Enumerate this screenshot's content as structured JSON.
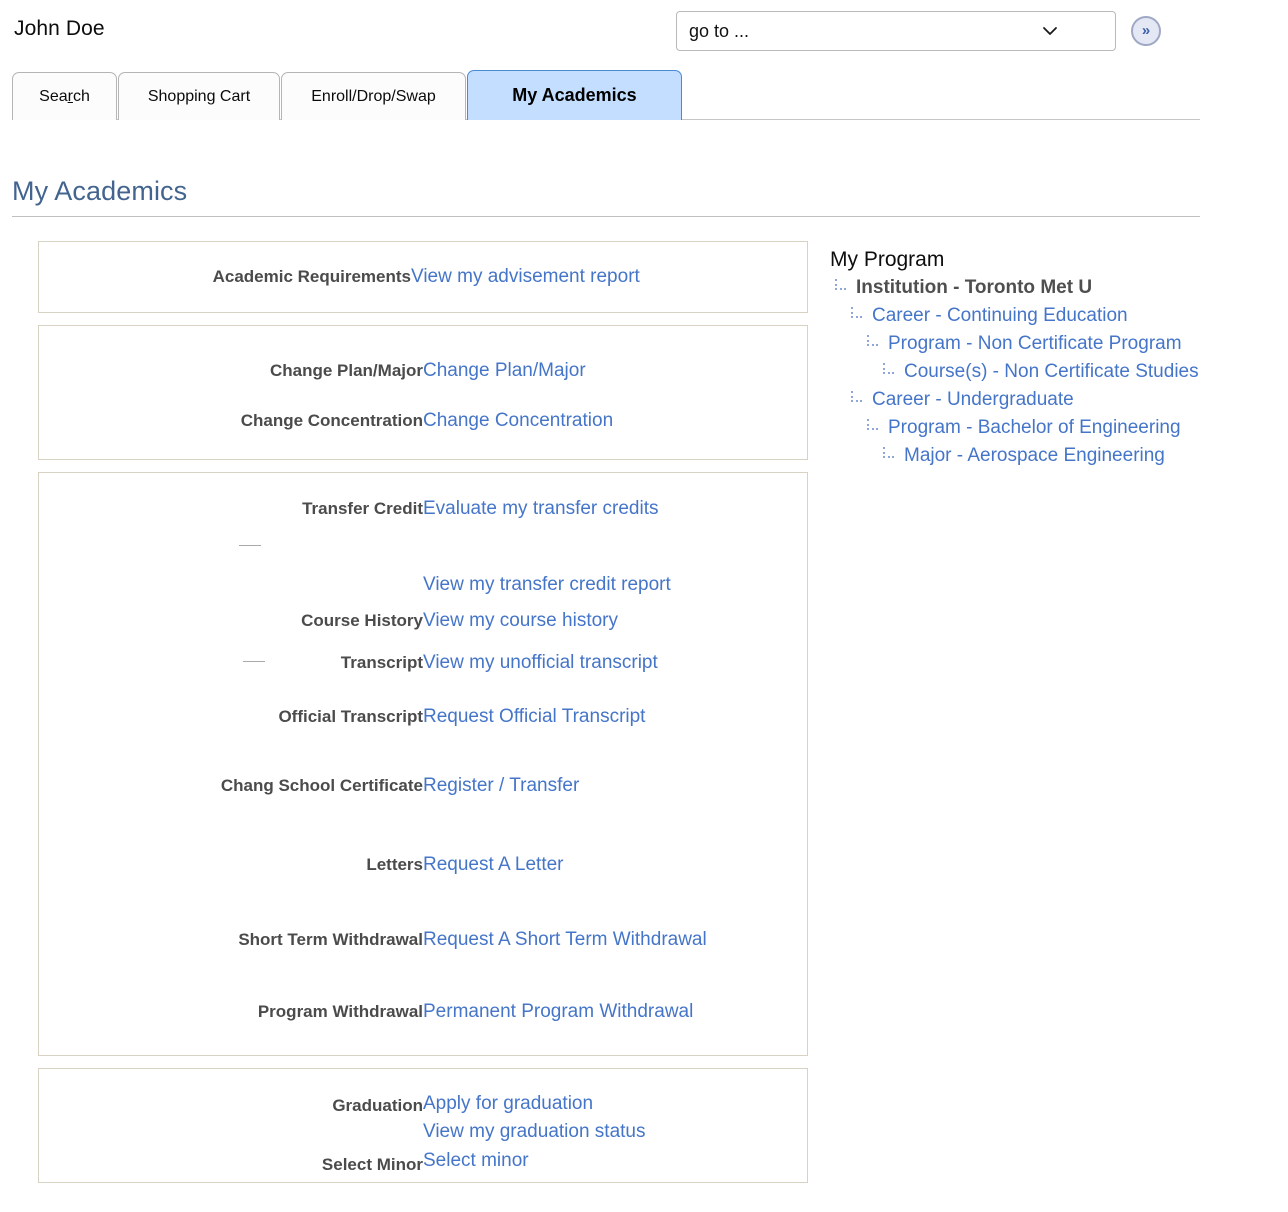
{
  "header": {
    "user_name": "John Doe",
    "goto": {
      "selected": "go to ...",
      "options": [
        "go to ..."
      ],
      "chevron_icon": "chevron-down-icon"
    },
    "go_button": {
      "glyph": "»",
      "icon": "double-chevron-right-icon"
    }
  },
  "tabs": [
    {
      "label": "Search",
      "accesskey_index": 3,
      "active": false
    },
    {
      "label": "Shopping Cart",
      "active": false
    },
    {
      "label": "Enroll/Drop/Swap",
      "active": false
    },
    {
      "label": "My Academics",
      "active": true
    }
  ],
  "page": {
    "title": "My Academics"
  },
  "panels": [
    {
      "name": "academic-requirements",
      "rows": [
        {
          "label": "Academic Requirements",
          "links": [
            "View my advisement report"
          ]
        }
      ]
    },
    {
      "name": "change-plan",
      "rows": [
        {
          "label": "Change Plan/Major",
          "links": [
            "Change Plan/Major"
          ]
        },
        {
          "label": "Change Concentration",
          "links": [
            "Change Concentration"
          ]
        }
      ]
    },
    {
      "name": "records-and-requests",
      "rows": [
        {
          "label": "Transfer Credit",
          "links": [
            "Evaluate my transfer credits"
          ]
        },
        {
          "label": "",
          "dash": true,
          "links": []
        },
        {
          "label": "",
          "links": [
            "View my transfer credit report"
          ]
        },
        {
          "label": "Course History",
          "links": [
            "View my course history"
          ]
        },
        {
          "label": "Transcript",
          "dash": true,
          "links": [
            "View my unofficial transcript"
          ]
        },
        {
          "label": "Official Transcript",
          "links": [
            "Request Official Transcript"
          ]
        },
        {
          "label": "Chang School Certificate",
          "links": [
            "Register / Transfer"
          ]
        },
        {
          "label": "Letters",
          "links": [
            "Request A Letter"
          ]
        },
        {
          "label": "Short Term Withdrawal",
          "links": [
            "Request A Short Term Withdrawal"
          ]
        },
        {
          "label": "Program Withdrawal",
          "links": [
            "Permanent Program Withdrawal"
          ]
        }
      ]
    },
    {
      "name": "graduation",
      "rows": [
        {
          "label": "Graduation",
          "links": [
            "Apply for graduation",
            "View my graduation status"
          ]
        },
        {
          "label": "Select Minor",
          "links": [
            "Select minor"
          ]
        }
      ]
    }
  ],
  "my_program": {
    "title": "My Program",
    "nodes": [
      {
        "label": "Institution - Toronto Met U",
        "level": 0,
        "type": "text"
      },
      {
        "label": "Career - Continuing Education",
        "level": 1,
        "type": "link"
      },
      {
        "label": "Program - Non Certificate Program",
        "level": 2,
        "type": "link"
      },
      {
        "label": "Course(s) - Non Certificate Studies",
        "level": 3,
        "type": "link"
      },
      {
        "label": "Career - Undergraduate",
        "level": 1,
        "type": "link"
      },
      {
        "label": "Program - Bachelor of Engineering",
        "level": 2,
        "type": "link"
      },
      {
        "label": "Major - Aerospace Engineering",
        "level": 3,
        "type": "link"
      }
    ]
  },
  "colors": {
    "link_blue": "#4575c8",
    "title_blue": "#42648f",
    "active_tab_bg": "#c3deff",
    "active_tab_border": "#4a8ad4",
    "panel_border": "#d7d2c2",
    "label_gray": "#4b4b4b",
    "tree_connector": "#8fa6d8"
  }
}
